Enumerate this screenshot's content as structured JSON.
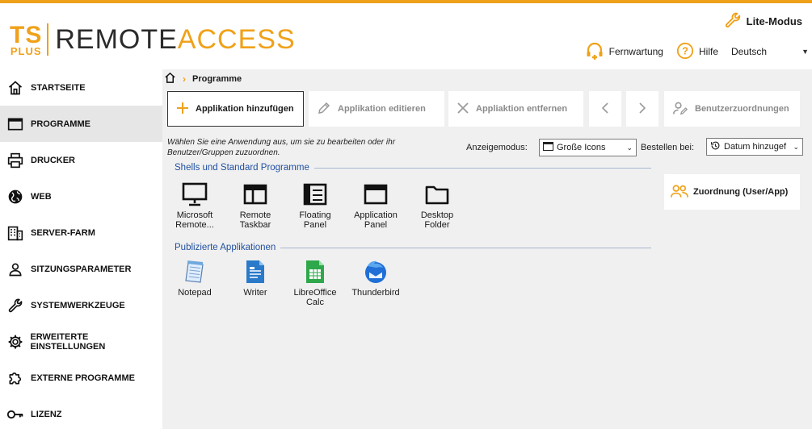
{
  "header": {
    "logo": {
      "ts": "TS",
      "plus": "PLUS",
      "remote": "REMOTE",
      "access": "ACCESS"
    },
    "lite_mode": "Lite-Modus",
    "remote_support": "Fernwartung",
    "help": "Hilfe",
    "language": "Deutsch"
  },
  "sidebar": {
    "items": [
      {
        "label": "STARTSEITE",
        "icon": "home-icon"
      },
      {
        "label": "PROGRAMME",
        "icon": "window-icon",
        "active": true
      },
      {
        "label": "DRUCKER",
        "icon": "printer-icon"
      },
      {
        "label": "WEB",
        "icon": "globe-icon"
      },
      {
        "label": "SERVER-FARM",
        "icon": "building-icon"
      },
      {
        "label": "SITZUNGSPARAMETER",
        "icon": "user-icon"
      },
      {
        "label": "SYSTEMWERKZEUGE",
        "icon": "wrench-icon"
      },
      {
        "label": "ERWEITERTE EINSTELLUNGEN",
        "icon": "gear-icon"
      },
      {
        "label": "EXTERNE PROGRAMME",
        "icon": "puzzle-icon"
      },
      {
        "label": "LIZENZ",
        "icon": "key-icon"
      }
    ]
  },
  "breadcrumb": {
    "current": "Programme"
  },
  "toolbar": {
    "add": "Applikation hinzufügen",
    "edit": "Applikation editieren",
    "remove": "Appliaktion entfernen",
    "user_assignments": "Benutzerzuordnungen"
  },
  "hint": "Wählen Sie eine Anwendung aus, um sie zu bearbeiten oder ihr Benutzer/Gruppen zuzuordnen.",
  "display_mode": {
    "label": "Anzeigemodus:",
    "value": "Große Icons"
  },
  "order_by": {
    "label": "Bestellen bei:",
    "value": "Datum hinzugef"
  },
  "groups": {
    "shells": {
      "title": "Shells und Standard Programme",
      "apps": [
        {
          "line1": "Microsoft",
          "line2": "Remote...",
          "icon": "monitor-icon"
        },
        {
          "line1": "Remote",
          "line2": "Taskbar",
          "icon": "taskbar-icon"
        },
        {
          "line1": "Floating",
          "line2": "Panel",
          "icon": "floating-panel-icon"
        },
        {
          "line1": "Application",
          "line2": "Panel",
          "icon": "application-panel-icon"
        },
        {
          "line1": "Desktop",
          "line2": "Folder",
          "icon": "folder-icon"
        }
      ]
    },
    "published": {
      "title": "Publizierte Applikationen",
      "apps": [
        {
          "line1": "Notepad",
          "line2": "",
          "icon": "notepad-icon"
        },
        {
          "line1": "Writer",
          "line2": "",
          "icon": "writer-icon"
        },
        {
          "line1": "LibreOffice",
          "line2": "Calc",
          "icon": "calc-icon"
        },
        {
          "line1": "Thunderbird",
          "line2": "",
          "icon": "thunderbird-icon"
        }
      ]
    }
  },
  "assign_button": "Zuordnung (User/App)",
  "colors": {
    "accent": "#f0a11a",
    "group_title": "#2150a0",
    "main_bg": "#f0f0f0",
    "active_nav": "#e6e6e6"
  }
}
